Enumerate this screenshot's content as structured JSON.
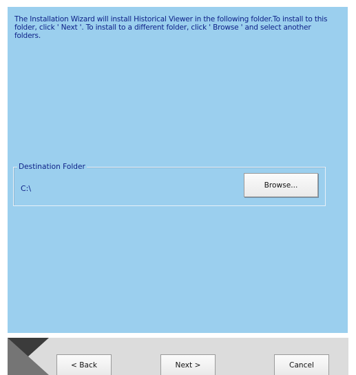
{
  "intro": {
    "text": "The Installation Wizard will install Historical Viewer in the following folder.To install to this folder, click ' Next '. To install to a different folder, click ' Browse ' and select another folders."
  },
  "destination": {
    "group_label": "Destination Folder",
    "path": "C:\\",
    "browse_label": "Browse..."
  },
  "footer": {
    "back_label": "< Back",
    "next_label": "Next >",
    "cancel_label": "Cancel"
  },
  "colors": {
    "panel_background": "#9bcfee",
    "text": "#0c1f86",
    "footer_background": "#3b3b3b",
    "footer_gray": "#dcdcdc",
    "window_background": "#ffffff"
  }
}
